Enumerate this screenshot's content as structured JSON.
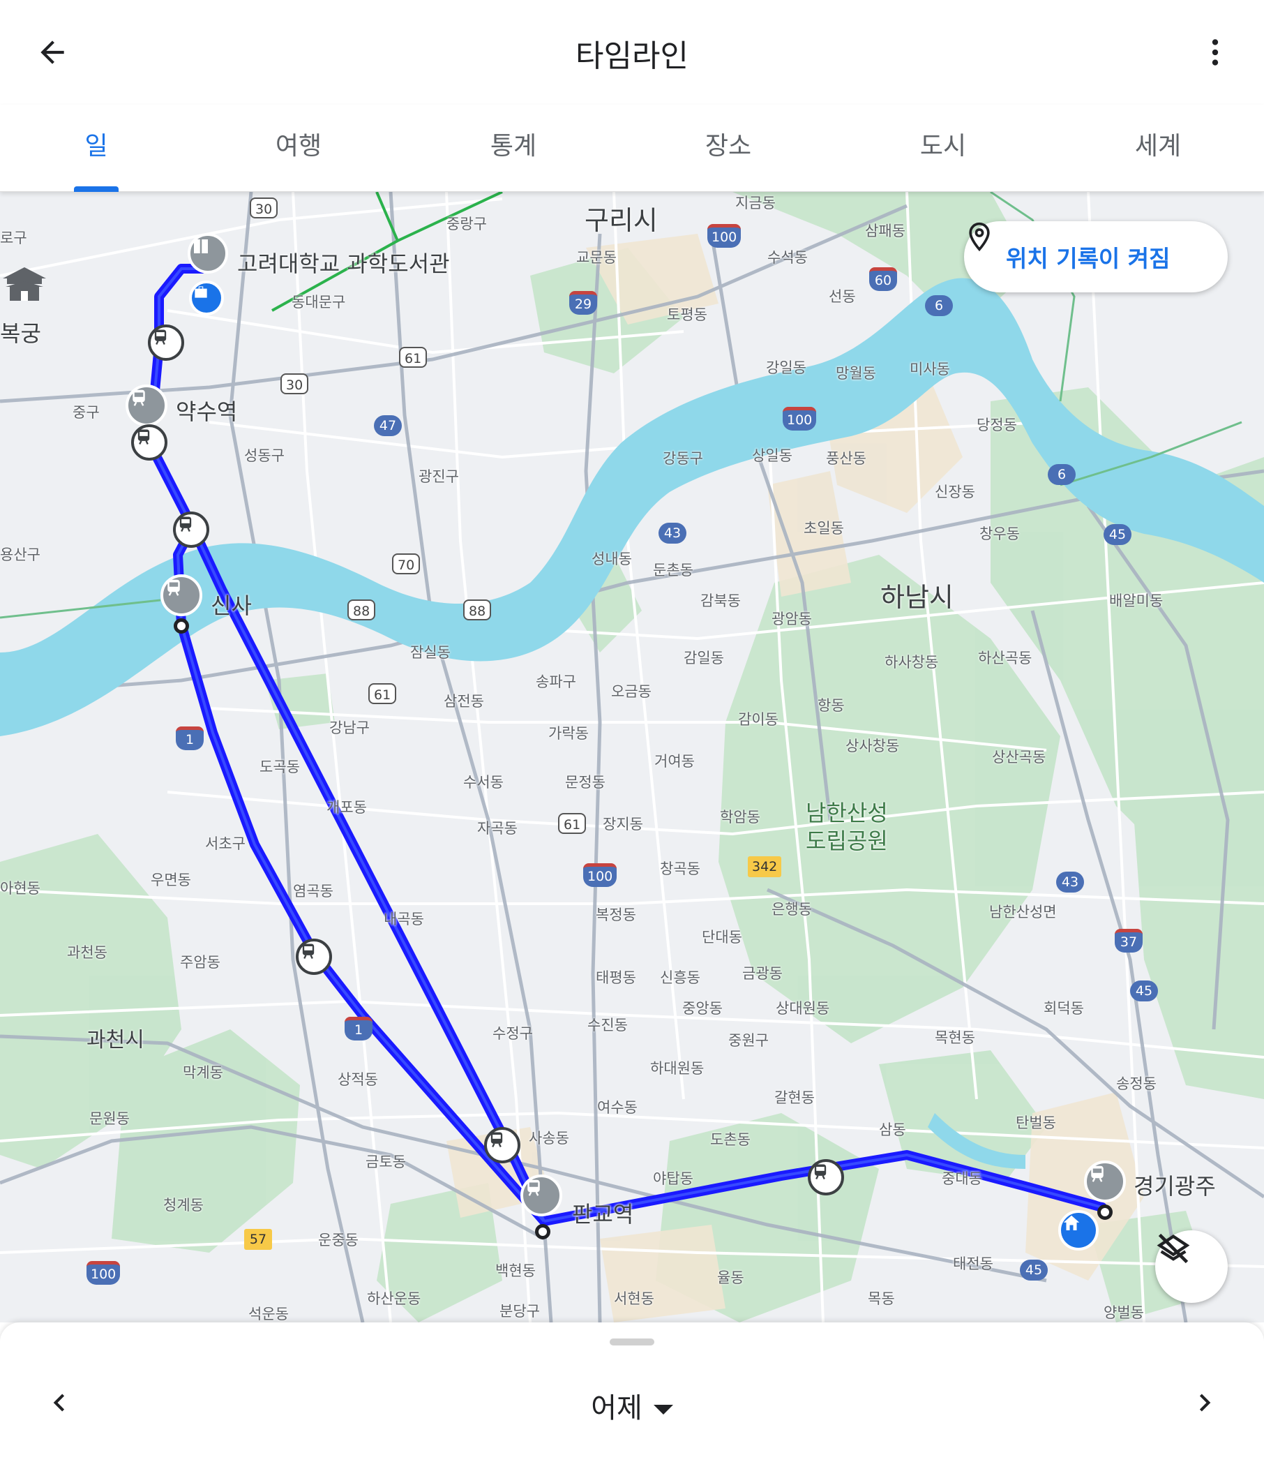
{
  "header": {
    "title": "타임라인",
    "back_icon": "arrow-back-icon",
    "more_icon": "more-vert-icon"
  },
  "tabs": [
    {
      "label": "일",
      "active": true
    },
    {
      "label": "여행",
      "active": false
    },
    {
      "label": "통계",
      "active": false
    },
    {
      "label": "장소",
      "active": false
    },
    {
      "label": "도시",
      "active": false
    },
    {
      "label": "세계",
      "active": false
    }
  ],
  "location_chip": {
    "icon": "location-pin-icon",
    "label": "위치 기록이 켜짐"
  },
  "layers_button": {
    "icon": "layers-off-icon"
  },
  "map": {
    "route_color": "#1a1aff",
    "water_color": "#8fd8ea",
    "park_color": "#c8e6c9",
    "place_labels": {
      "guri": "구리시",
      "hanam": "하남시",
      "namhansanseong": "남한산성\n도립공원",
      "gwacheon": "과천시",
      "korea_univ": "고려대학교 과학도서관",
      "yaksu": "약수역",
      "sinsa": "신사",
      "pangyo": "판교역",
      "gyeonggi_gwangju": "경기광주",
      "bokgung": "복궁",
      "jongno": "로구",
      "junggu": "중구",
      "seongdong": "성동구",
      "dongdaemun": "동대문구",
      "jungnang": "중랑구",
      "gyomun": "교문동",
      "topyeong": "토평동",
      "jigeum": "지금동",
      "supae": "삼패동",
      "suseok": "수석동",
      "seondong": "선동",
      "misa": "미사동",
      "mangwol": "망월동",
      "gangil": "강일동",
      "dangjeong": "당정동",
      "gangdong": "강동구",
      "sangil": "상일동",
      "pungsan": "풍산동",
      "sinjang": "신장동",
      "gwangjin": "광진구",
      "yongsan": "용산구",
      "chogil": "초일동",
      "changu": "창우동",
      "seongnae": "성내동",
      "dunchon": "둔촌동",
      "baealmi": "배알미동",
      "gambuk": "감북동",
      "gwangam": "광암동",
      "hasachang": "하사창동",
      "hasangok": "하산곡동",
      "jamsil": "잠실동",
      "songpa": "송파구",
      "ogeum": "오금동",
      "gamil": "감일동",
      "samjeon": "삼전동",
      "garak": "가락동",
      "gamidong": "감이동",
      "hang": "항동",
      "sangsachang": "상사창동",
      "sangsangok": "상산곡동",
      "gangnam": "강남구",
      "dogok": "도곡동",
      "geoyeo": "거여동",
      "suseo": "수서동",
      "munjeong": "문정동",
      "gaepo": "개포동",
      "haam": "학암동",
      "jagok": "자곡동",
      "jangji": "장지동",
      "seocho": "서초구",
      "changgok": "창곡동",
      "ahyeon": "아현동",
      "umyeon": "우면동",
      "yeomgok": "염곡동",
      "naegok": "내곡동",
      "bokjeong": "복정동",
      "eunhaeng": "은행동",
      "namhansanseongmyeon": "남한산성면",
      "gwacheondong": "과천동",
      "juam": "주암동",
      "dandae": "단대동",
      "taepyeong": "태평동",
      "sinheung": "신흥동",
      "geumgwang": "금광동",
      "jungang": "중앙동",
      "sangdaewon": "상대원동",
      "hoedeok": "회덕동",
      "sujeong": "수정구",
      "sujin": "수진동",
      "jungwon": "중원구",
      "mokhyeon": "목현동",
      "makgye": "막계동",
      "sangjeok": "상적동",
      "hadaewon": "하대원동",
      "songjeong": "송정동",
      "yeosu": "여수동",
      "galhyeon": "갈현동",
      "munwon": "문원동",
      "sasong": "사송동",
      "dochon": "도촌동",
      "samdong": "삼동",
      "tanbeol": "탄벌동",
      "geumto": "금토동",
      "yatap": "야탑동",
      "jungdae": "중대동",
      "cheonggye": "청계동",
      "unjung": "운중동",
      "taejeon": "태전동",
      "baekhyeon": "백현동",
      "yuldong": "율동",
      "hasanun": "하산운동",
      "seohyeon": "서현동",
      "mokdong": "목동",
      "seogun": "석운동",
      "bundang": "분당구",
      "yangbeol": "양벌동"
    },
    "road_shields": [
      "30",
      "30",
      "29",
      "100",
      "100",
      "100",
      "100",
      "61",
      "61",
      "61",
      "47",
      "60",
      "6",
      "6",
      "43",
      "43",
      "45",
      "45",
      "45",
      "70",
      "88",
      "88",
      "1",
      "1",
      "342",
      "37",
      "57",
      "100"
    ],
    "icons": [
      "book-icon",
      "briefcase-icon",
      "train-icon",
      "home-icon",
      "palace-icon"
    ]
  },
  "bottom": {
    "date_label": "어제",
    "prev_icon": "chevron-left-icon",
    "next_icon": "chevron-right-icon"
  }
}
